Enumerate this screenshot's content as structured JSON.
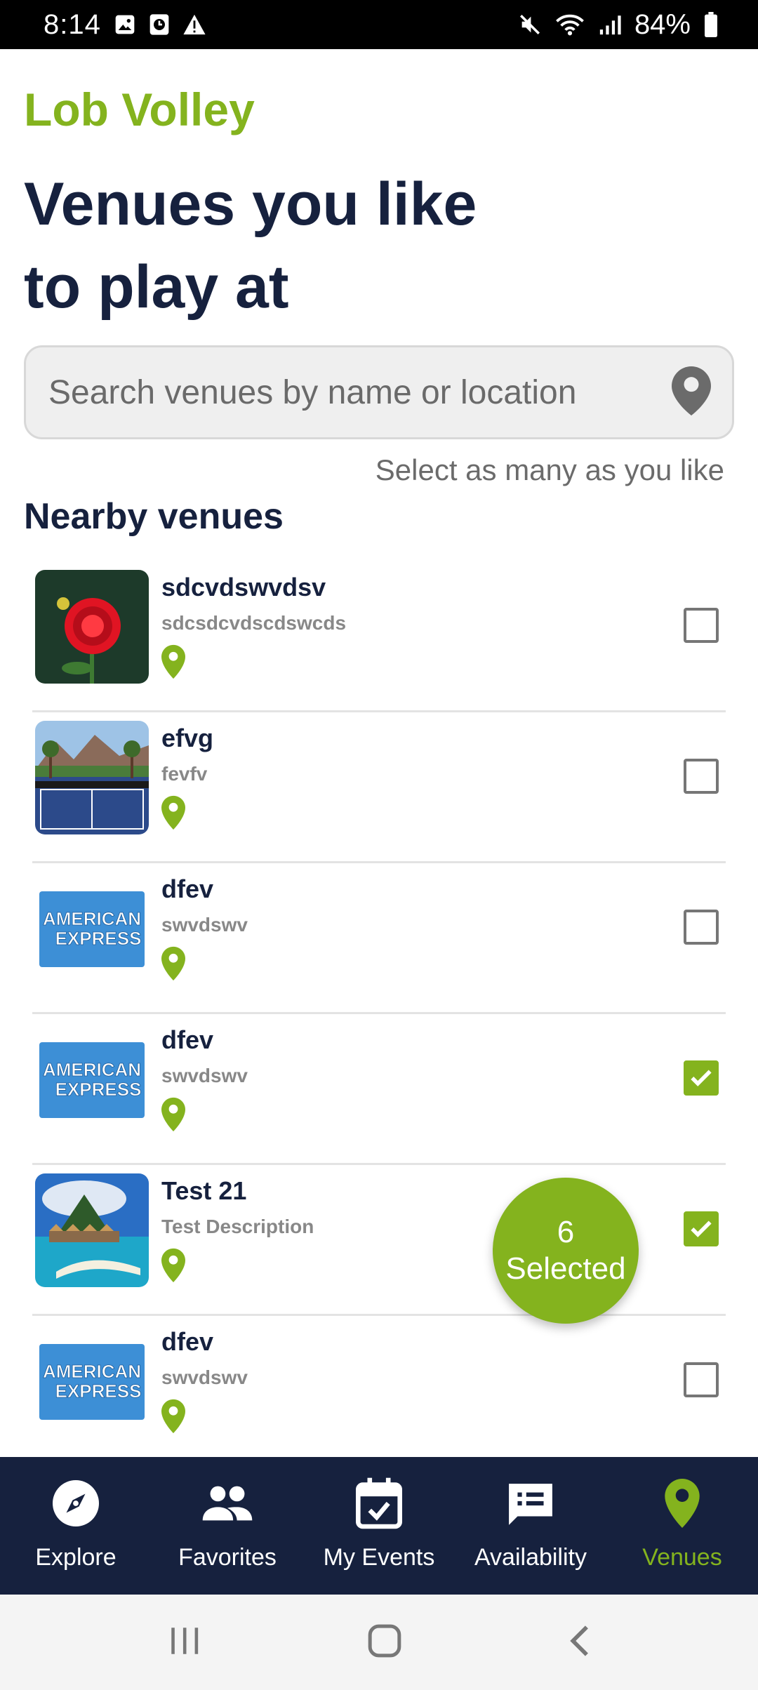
{
  "status_bar": {
    "time": "8:14",
    "battery": "84%"
  },
  "app": {
    "brand": "Lob Volley",
    "headline": "Venues you like\nto play at",
    "accent_color": "#84b31e",
    "dark_color": "#16213e"
  },
  "search": {
    "placeholder": "Search venues by name or location",
    "value": "",
    "icon": "location-pin-icon"
  },
  "hint": "Select as many as you like",
  "section_title": "Nearby venues",
  "venues": [
    {
      "name": "sdcvdswvdsv",
      "description": "sdcsdcvdscdswcds",
      "image": "red-flower",
      "checked": false
    },
    {
      "name": "efvg",
      "description": "fevfv",
      "image": "tennis-court-resort",
      "checked": false
    },
    {
      "name": "dfev",
      "description": "swvdswv",
      "image": "american-express-logo",
      "checked": false
    },
    {
      "name": "dfev",
      "description": "swvdswv",
      "image": "american-express-logo",
      "checked": true
    },
    {
      "name": "Test 21",
      "description": "Test Description",
      "image": "tropical-island",
      "checked": true
    },
    {
      "name": "dfev",
      "description": "swvdswv",
      "image": "american-express-logo",
      "checked": false
    }
  ],
  "amex_logo_text": {
    "line1": "AMERICAN",
    "line2": "EXPRESS"
  },
  "selected_badge": {
    "count": "6",
    "label": "Selected"
  },
  "bottom_nav": [
    {
      "label": "Explore",
      "icon": "compass-icon",
      "active": false
    },
    {
      "label": "Favorites",
      "icon": "people-icon",
      "active": false
    },
    {
      "label": "My Events",
      "icon": "calendar-check-icon",
      "active": false
    },
    {
      "label": "Availability",
      "icon": "chat-list-icon",
      "active": false
    },
    {
      "label": "Venues",
      "icon": "location-pin-icon",
      "active": true
    }
  ],
  "system_nav": [
    "recents-icon",
    "home-icon",
    "back-icon"
  ]
}
